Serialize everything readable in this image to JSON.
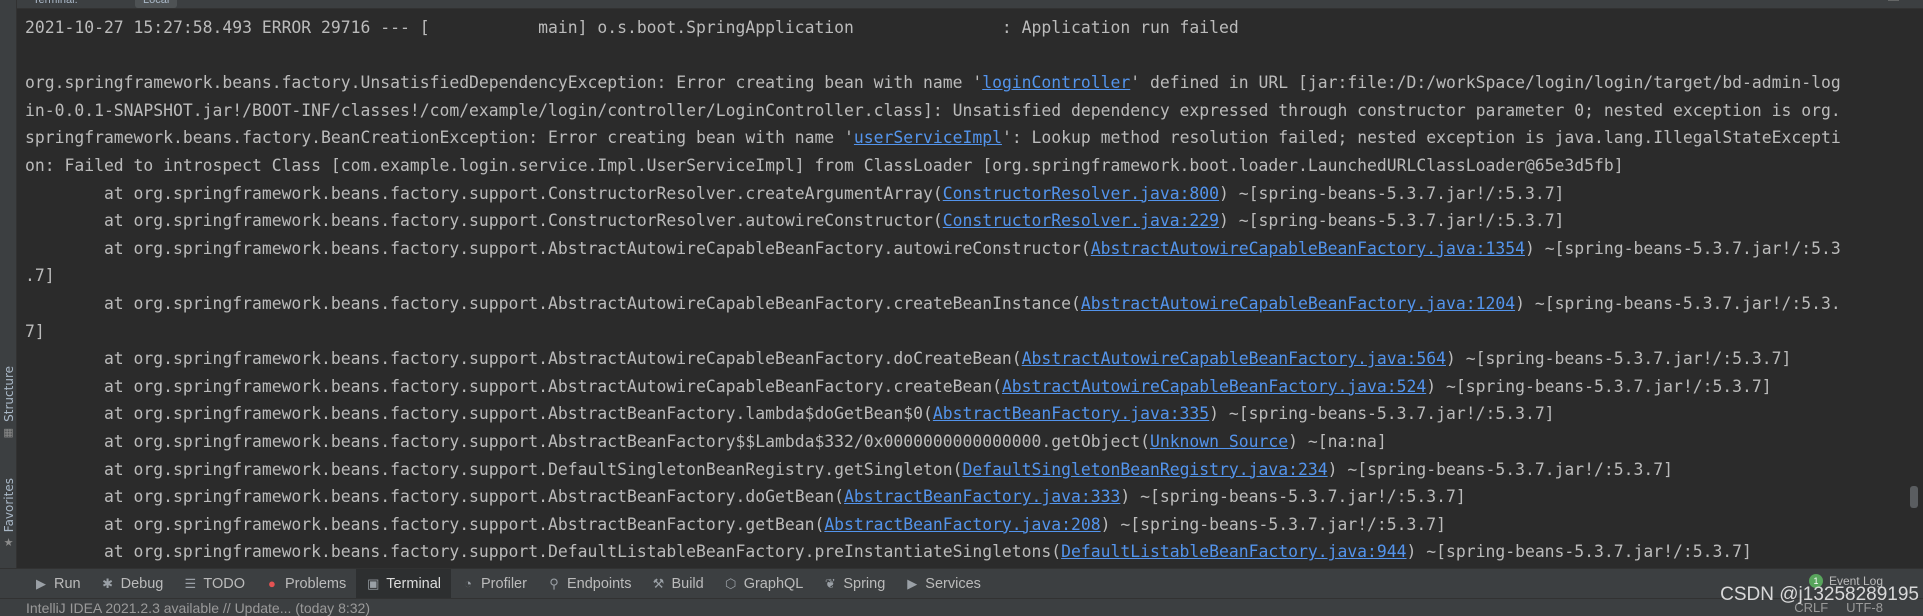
{
  "window_tabs": [
    "Terminal:",
    "Local"
  ],
  "side_tabs": {
    "structure": "Structure",
    "favorites": "Favorites"
  },
  "log_lines": [
    [
      {
        "t": "2021-10-27 15:27:58.493 ERROR 29716 --- [           main] o.s.boot.SpringApplication               : Application run failed"
      }
    ],
    [
      {
        "t": ""
      }
    ],
    [
      {
        "t": "org.springframework.beans.factory.UnsatisfiedDependencyException: Error creating bean with name '"
      },
      {
        "t": "loginController",
        "link": true
      },
      {
        "t": "' defined in URL [jar:file:/D:/workSpace/login/login/target/bd-admin-log"
      }
    ],
    [
      {
        "t": "in-0.0.1-SNAPSHOT.jar!/BOOT-INF/classes!/com/example/login/controller/LoginController.class]: Unsatisfied dependency expressed through constructor parameter 0; nested exception is org."
      }
    ],
    [
      {
        "t": "springframework.beans.factory.BeanCreationException: Error creating bean with name '"
      },
      {
        "t": "userServiceImpl",
        "link": true
      },
      {
        "t": "': Lookup method resolution failed; nested exception is java.lang.IllegalStateExcepti"
      }
    ],
    [
      {
        "t": "on: Failed to introspect Class [com.example.login.service.Impl.UserServiceImpl] from ClassLoader [org.springframework.boot.loader.LaunchedURLClassLoader@65e3d5fb]"
      }
    ],
    [
      {
        "t": "        at org.springframework.beans.factory.support.ConstructorResolver.createArgumentArray("
      },
      {
        "t": "ConstructorResolver.java:800",
        "link": true
      },
      {
        "t": ") ~[spring-beans-5.3.7.jar!/:5.3.7]"
      }
    ],
    [
      {
        "t": "        at org.springframework.beans.factory.support.ConstructorResolver.autowireConstructor("
      },
      {
        "t": "ConstructorResolver.java:229",
        "link": true
      },
      {
        "t": ") ~[spring-beans-5.3.7.jar!/:5.3.7]"
      }
    ],
    [
      {
        "t": "        at org.springframework.beans.factory.support.AbstractAutowireCapableBeanFactory.autowireConstructor("
      },
      {
        "t": "AbstractAutowireCapableBeanFactory.java:1354",
        "link": true
      },
      {
        "t": ") ~[spring-beans-5.3.7.jar!/:5.3"
      }
    ],
    [
      {
        "t": ".7]"
      }
    ],
    [
      {
        "t": "        at org.springframework.beans.factory.support.AbstractAutowireCapableBeanFactory.createBeanInstance("
      },
      {
        "t": "AbstractAutowireCapableBeanFactory.java:1204",
        "link": true
      },
      {
        "t": ") ~[spring-beans-5.3.7.jar!/:5.3."
      }
    ],
    [
      {
        "t": "7]"
      }
    ],
    [
      {
        "t": "        at org.springframework.beans.factory.support.AbstractAutowireCapableBeanFactory.doCreateBean("
      },
      {
        "t": "AbstractAutowireCapableBeanFactory.java:564",
        "link": true
      },
      {
        "t": ") ~[spring-beans-5.3.7.jar!/:5.3.7]"
      }
    ],
    [
      {
        "t": "        at org.springframework.beans.factory.support.AbstractAutowireCapableBeanFactory.createBean("
      },
      {
        "t": "AbstractAutowireCapableBeanFactory.java:524",
        "link": true
      },
      {
        "t": ") ~[spring-beans-5.3.7.jar!/:5.3.7]"
      }
    ],
    [
      {
        "t": "        at org.springframework.beans.factory.support.AbstractBeanFactory.lambda$doGetBean$0("
      },
      {
        "t": "AbstractBeanFactory.java:335",
        "link": true
      },
      {
        "t": ") ~[spring-beans-5.3.7.jar!/:5.3.7]"
      }
    ],
    [
      {
        "t": "        at org.springframework.beans.factory.support.AbstractBeanFactory$$Lambda$332/0x0000000000000000.getObject("
      },
      {
        "t": "Unknown Source",
        "link": true
      },
      {
        "t": ") ~[na:na]"
      }
    ],
    [
      {
        "t": "        at org.springframework.beans.factory.support.DefaultSingletonBeanRegistry.getSingleton("
      },
      {
        "t": "DefaultSingletonBeanRegistry.java:234",
        "link": true
      },
      {
        "t": ") ~[spring-beans-5.3.7.jar!/:5.3.7]"
      }
    ],
    [
      {
        "t": "        at org.springframework.beans.factory.support.AbstractBeanFactory.doGetBean("
      },
      {
        "t": "AbstractBeanFactory.java:333",
        "link": true
      },
      {
        "t": ") ~[spring-beans-5.3.7.jar!/:5.3.7]"
      }
    ],
    [
      {
        "t": "        at org.springframework.beans.factory.support.AbstractBeanFactory.getBean("
      },
      {
        "t": "AbstractBeanFactory.java:208",
        "link": true
      },
      {
        "t": ") ~[spring-beans-5.3.7.jar!/:5.3.7]"
      }
    ],
    [
      {
        "t": "        at org.springframework.beans.factory.support.DefaultListableBeanFactory.preInstantiateSingletons("
      },
      {
        "t": "DefaultListableBeanFactory.java:944",
        "link": true
      },
      {
        "t": ") ~[spring-beans-5.3.7.jar!/:5.3.7]"
      }
    ]
  ],
  "tool_windows": [
    {
      "label": "Run",
      "icon": "play-icon",
      "glyph": "▶"
    },
    {
      "label": "Debug",
      "icon": "bug-icon",
      "glyph": "✱"
    },
    {
      "label": "TODO",
      "icon": "list-icon",
      "glyph": "☰"
    },
    {
      "label": "Problems",
      "icon": "error-circle-icon",
      "glyph": "●",
      "red": true
    },
    {
      "label": "Terminal",
      "icon": "terminal-icon",
      "glyph": "▣",
      "active": true
    },
    {
      "label": "Profiler",
      "icon": "profiler-icon",
      "glyph": "◔"
    },
    {
      "label": "Endpoints",
      "icon": "endpoints-icon",
      "glyph": "⚲"
    },
    {
      "label": "Build",
      "icon": "hammer-icon",
      "glyph": "⚒"
    },
    {
      "label": "GraphQL",
      "icon": "graphql-icon",
      "glyph": "⬡"
    },
    {
      "label": "Spring",
      "icon": "spring-leaf-icon",
      "glyph": "❦"
    },
    {
      "label": "Services",
      "icon": "services-icon",
      "glyph": "▶"
    }
  ],
  "event_log": {
    "badge": "1",
    "label": "Event Log"
  },
  "status": {
    "message": "IntelliJ IDEA 2021.2.3 available // Update... (today 8:32)",
    "line_sep": "CRLF",
    "encoding": "UTF-8"
  },
  "watermark": "CSDN @j13258289195",
  "colors": {
    "background": "#2b2b2b",
    "text": "#bbbbbb",
    "link": "#5394ec",
    "panel": "#3c3f41"
  }
}
